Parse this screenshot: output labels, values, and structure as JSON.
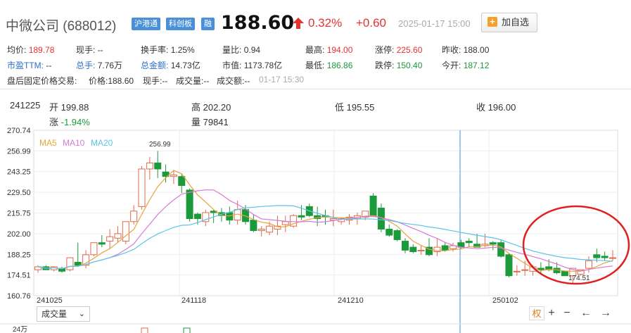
{
  "header": {
    "name": "中微公司 (688012)",
    "tags": [
      "沪港通",
      "科创板",
      "融"
    ],
    "price": "188.60",
    "pct": "0.32%",
    "change": "+0.60",
    "time": "2025-01-17 15:00",
    "add_watch": "加自选"
  },
  "stats": {
    "avg_label": "均价:",
    "avg": "189.78",
    "now_label": "现手:",
    "now": "--",
    "turnover_label": "换手率:",
    "turnover": "1.25%",
    "volratio_label": "量比:",
    "volratio": "0.94",
    "high_label": "最高:",
    "high": "194.00",
    "limitup_label": "涨停:",
    "limitup": "225.60",
    "prevclose_label": "昨收:",
    "prevclose": "188.00",
    "pe_label": "市盈TTM:",
    "pe": "--",
    "total_hands_label": "总手:",
    "total_hands": "7.76万",
    "amount_label": "总金额:",
    "amount": "14.73亿",
    "mcap_label": "市值:",
    "mcap": "1173.78亿",
    "low_label": "最低:",
    "low": "186.86",
    "limitdown_label": "跌停:",
    "limitdown": "150.40",
    "open_label": "今开:",
    "open": "187.12",
    "after_label": "盘后固定价格交易:",
    "after_price_label": "价格:188.60",
    "after_now": "现手:--",
    "after_vol": "成交量:--",
    "after_amt": "成交额:--",
    "after_time": "01-17 15:30"
  },
  "ohlc": {
    "date": "241225",
    "open": "开 199.88",
    "high": "高 202.20",
    "low": "低 195.55",
    "close": "收 196.00",
    "chg_label": "涨",
    "chg": "-1.94%",
    "vol": "量 79841"
  },
  "chart_data": {
    "type": "candlestick",
    "legend": [
      {
        "name": "MA5",
        "color": "#e8a33d"
      },
      {
        "name": "MA10",
        "color": "#d77bd8"
      },
      {
        "name": "MA20",
        "color": "#5ec4e8"
      }
    ],
    "y_ticks": [
      "270.74",
      "256.99",
      "243.25",
      "229.50",
      "215.75",
      "202.00",
      "188.25",
      "174.51",
      "160.76"
    ],
    "ylim": [
      160.76,
      270.74
    ],
    "x_labels": [
      "241025",
      "241118",
      "241210",
      "250102"
    ],
    "high_annotation": "256.99",
    "low_annotation": "174.51",
    "volume_label": "24万",
    "candles": [
      [
        178,
        181,
        176,
        180
      ],
      [
        180,
        181,
        178,
        178
      ],
      [
        178,
        180,
        177,
        180
      ],
      [
        179,
        180,
        176,
        177
      ],
      [
        178,
        186,
        177,
        186
      ],
      [
        183,
        196,
        180,
        181
      ],
      [
        181,
        191,
        179,
        188
      ],
      [
        188,
        196,
        187,
        196
      ],
      [
        196,
        201,
        193,
        195
      ],
      [
        197,
        205,
        192,
        200
      ],
      [
        199,
        207,
        196,
        202
      ],
      [
        197,
        210,
        195,
        210
      ],
      [
        210,
        221,
        208,
        217
      ],
      [
        220,
        247,
        218,
        245
      ],
      [
        245,
        253,
        238,
        249
      ],
      [
        249,
        257,
        239,
        245
      ],
      [
        243,
        248,
        236,
        240
      ],
      [
        240,
        244,
        235,
        241
      ],
      [
        240,
        242,
        229,
        234
      ],
      [
        231,
        232,
        210,
        212
      ],
      [
        215,
        216,
        208,
        212
      ],
      [
        210,
        218,
        207,
        216
      ],
      [
        217,
        218,
        209,
        216
      ],
      [
        216,
        219,
        210,
        214
      ],
      [
        216,
        220,
        208,
        211
      ],
      [
        211,
        224,
        208,
        218
      ],
      [
        218,
        221,
        208,
        210
      ],
      [
        211,
        215,
        203,
        204
      ],
      [
        204,
        207,
        200,
        205
      ],
      [
        203,
        210,
        201,
        207
      ],
      [
        205,
        214,
        201,
        207
      ],
      [
        208,
        214,
        203,
        210
      ],
      [
        207,
        215,
        206,
        214
      ],
      [
        214,
        221,
        211,
        213
      ],
      [
        220,
        222,
        213,
        214
      ],
      [
        214,
        220,
        207,
        212
      ],
      [
        214,
        218,
        208,
        213
      ],
      [
        211,
        218,
        207,
        212
      ],
      [
        210,
        213,
        208,
        212
      ],
      [
        211,
        215,
        208,
        213
      ],
      [
        212,
        216,
        208,
        214
      ],
      [
        213,
        216,
        211,
        217
      ],
      [
        227,
        229,
        213,
        214
      ],
      [
        219,
        222,
        203,
        205
      ],
      [
        205,
        208,
        200,
        201
      ],
      [
        204,
        205,
        197,
        198
      ],
      [
        197,
        199,
        189,
        191
      ],
      [
        193,
        195,
        189,
        190
      ],
      [
        191,
        194,
        188,
        191
      ],
      [
        193,
        199,
        187,
        188
      ],
      [
        190,
        199,
        187,
        193
      ],
      [
        194,
        196,
        190,
        191
      ],
      [
        192,
        196,
        190,
        194
      ],
      [
        196,
        198,
        192,
        193
      ],
      [
        197,
        199,
        193,
        196
      ],
      [
        195,
        202,
        193,
        193
      ],
      [
        194,
        202,
        193,
        195
      ],
      [
        196,
        197,
        191,
        195
      ],
      [
        196,
        198,
        186,
        187
      ],
      [
        188,
        189,
        173,
        174
      ],
      [
        177,
        181,
        174,
        177
      ],
      [
        178,
        184,
        174,
        178
      ],
      [
        177,
        181,
        174,
        180
      ],
      [
        179,
        183,
        175,
        178
      ],
      [
        180,
        185,
        177,
        178
      ],
      [
        179,
        183,
        175,
        176
      ],
      [
        177,
        177,
        174,
        174
      ],
      [
        174,
        175,
        169,
        179
      ],
      [
        175,
        178,
        174,
        178
      ],
      [
        179,
        187,
        176,
        184
      ],
      [
        188,
        192,
        183,
        186
      ],
      [
        187,
        190,
        184,
        186
      ],
      [
        186,
        191,
        184,
        186
      ]
    ]
  },
  "toolbar": {
    "volume_select": "成交量",
    "quan": "权",
    "plus": "+",
    "minus": "−",
    "left": "←",
    "right": "→"
  }
}
